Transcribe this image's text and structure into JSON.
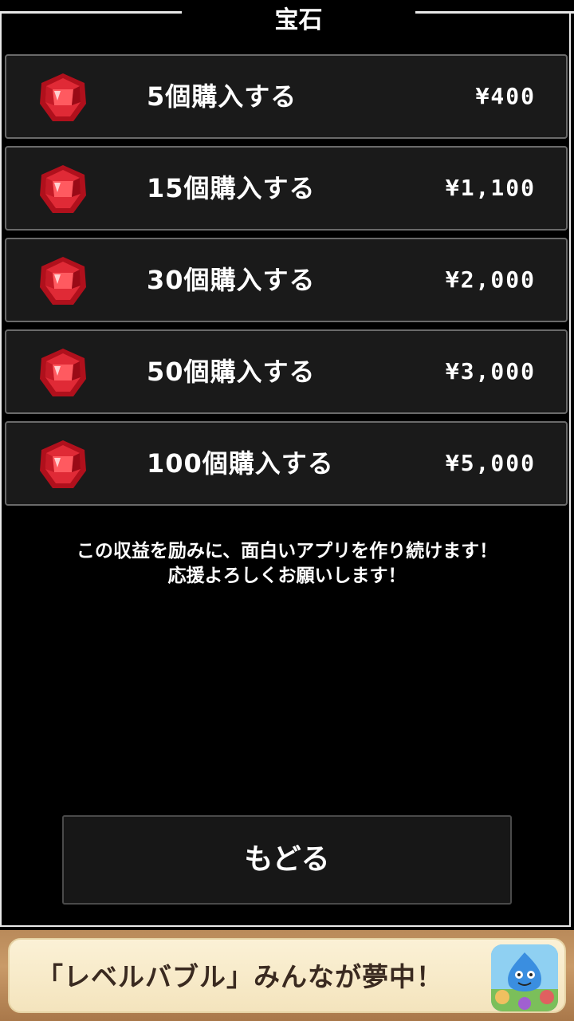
{
  "header": {
    "title": "宝石"
  },
  "shop": {
    "items": [
      {
        "label": "5個購入する",
        "price": "¥400"
      },
      {
        "label": "15個購入する",
        "price": "¥1,100"
      },
      {
        "label": "30個購入する",
        "price": "¥2,000"
      },
      {
        "label": "50個購入する",
        "price": "¥3,000"
      },
      {
        "label": "100個購入する",
        "price": "¥5,000"
      }
    ]
  },
  "message": {
    "line1": "この収益を励みに、面白いアプリを作り続けます！",
    "line2": "応援よろしくお願いします！"
  },
  "back_button": {
    "label": "もどる"
  },
  "banner": {
    "text": "「レベルバブル」みんなが夢中！",
    "icon": "app-icon"
  },
  "colors": {
    "gem": "#d81e2a",
    "background": "#000000",
    "item_bg": "#1a1a1a"
  }
}
